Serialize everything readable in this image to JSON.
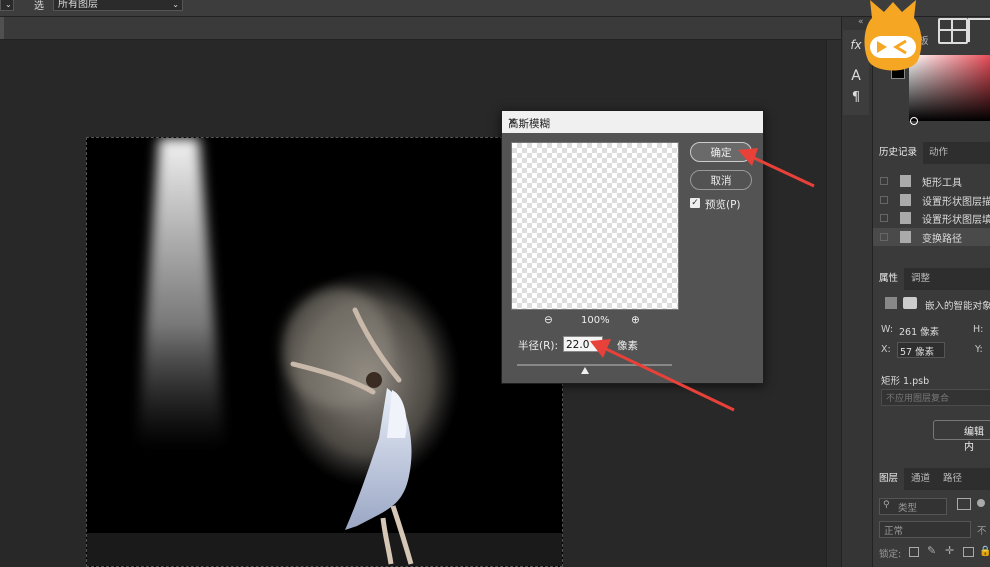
{
  "options_bar": {
    "select1_label": "选",
    "layer_scope": "所有图层"
  },
  "tools": {
    "fx_label": "fx",
    "text_tool_label": "A",
    "paragraph_label": "¶"
  },
  "panels": {
    "top_tab_partial": "板",
    "history_tabs": [
      "历史记录",
      "动作"
    ],
    "history_items": [
      {
        "label": "矩形工具"
      },
      {
        "label": "设置形状图层描"
      },
      {
        "label": "设置形状图层填"
      },
      {
        "label": "变换路径"
      }
    ],
    "properties_tabs": [
      "属性",
      "调整"
    ],
    "properties": {
      "embedded_label": "嵌入的智能对象",
      "w_label": "W:",
      "w_value": "261 像素",
      "h_label": "H:",
      "x_label": "X:",
      "x_value": "57 像素",
      "y_label": "Y:",
      "file_name": "矩形 1.psb",
      "comp_placeholder": "不应用图层复合",
      "edit_button": "编辑内"
    },
    "layers_tabs": [
      "图层",
      "通道",
      "路径"
    ],
    "layers": {
      "kind_filter": "类型",
      "blend_mode": "正常",
      "opacity_partial": "不",
      "lock_label": "锁定:"
    }
  },
  "dialog": {
    "title": "高斯模糊",
    "ok_label": "确定",
    "cancel_label": "取消",
    "preview_label": "预览(P)",
    "preview_checked": true,
    "zoom_level": "100%",
    "radius_label": "半径(R):",
    "radius_value": "22.0",
    "radius_unit": "像素",
    "radius_slider_fraction": 0.44
  },
  "colors": {
    "annotation_arrow": "#e8413a",
    "logo_orange": "#f5a623"
  }
}
